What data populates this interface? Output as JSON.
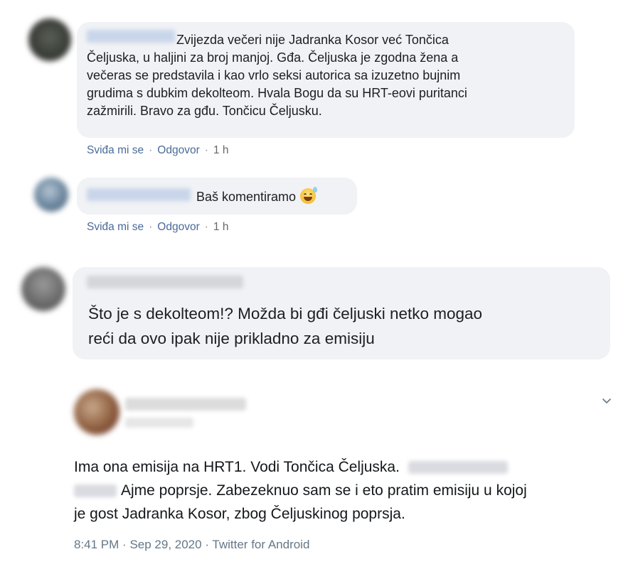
{
  "comments": [
    {
      "text_lines": [
        "Zvijezda večeri nije Jadranka Kosor već Tončica",
        "Čeljuska, u haljini za broj manjoj. Gđa. Čeljuska je zgodna žena a",
        "večeras se predstavila i kao vrlo seksi autorica sa izuzetno bujnim",
        "grudima s dubkim dekolteom. Hvala Bogu da su HRT-eovi puritanci",
        "zažmirili. Bravo za gđu. Tončicu Čeljusku."
      ],
      "like_label": "Sviđa mi se",
      "reply_label": "Odgovor",
      "time": "1 h"
    },
    {
      "text": "Baš komentiramo",
      "emoji": "grinning-sweat-emoji",
      "like_label": "Sviđa mi se",
      "reply_label": "Odgovor",
      "time": "1 h"
    },
    {
      "text_lines": [
        "Što je s dekolteom!? Možda bi gđi čeljuski netko mogao",
        "reći da ovo ipak nije prikladno za emisiju"
      ]
    }
  ],
  "tweet": {
    "line1": "Ima ona emisija na HRT1. Vodi Tončica Čeljuska.",
    "line2": "Ajme poprsje. Zabezeknuo sam se i eto pratim emisiju u kojoj",
    "line3": "je gost Jadranka Kosor, zbog Čeljuskinog poprsja.",
    "time": "8:41 PM",
    "date": "Sep 29, 2020",
    "source": "Twitter for Android",
    "menu_icon": "chevron-down-icon"
  },
  "colors": {
    "bubble": "#f0f2f5",
    "action_link": "#4a6a9b",
    "meta_gray": "#657786"
  }
}
